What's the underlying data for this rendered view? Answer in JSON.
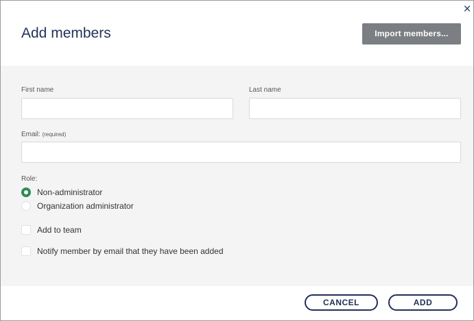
{
  "dialog": {
    "title": "Add members",
    "close_label": "×",
    "import_label": "Import members..."
  },
  "form": {
    "first_name_label": "First name",
    "first_name_value": "",
    "last_name_label": "Last name",
    "last_name_value": "",
    "email_label": "Email:",
    "email_required": "(required)",
    "email_value": "",
    "role_label": "Role:",
    "roles": [
      {
        "label": "Non-administrator",
        "selected": true
      },
      {
        "label": "Organization administrator",
        "selected": false
      }
    ],
    "add_to_team_label": "Add to team",
    "notify_label": "Notify member by email that they have been added"
  },
  "footer": {
    "cancel_label": "CANCEL",
    "add_label": "ADD"
  },
  "colors": {
    "title": "#23335a",
    "import_button_bg": "#7b7e82",
    "form_bg": "#f4f4f4",
    "radio_selected": "#2e8b57",
    "button_border": "#1f2f55"
  }
}
